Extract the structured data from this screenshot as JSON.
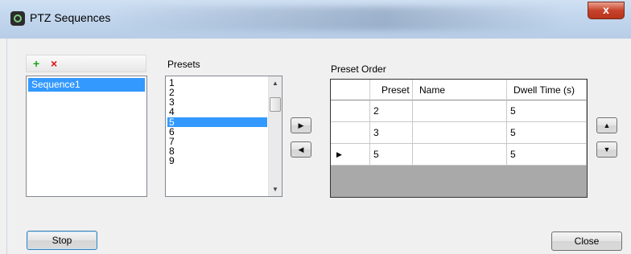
{
  "window": {
    "title": "PTZ Sequences",
    "close_glyph": "x"
  },
  "sequences": {
    "toolbar": {
      "add_glyph": "+",
      "delete_glyph": "×"
    },
    "items": [
      "Sequence1"
    ],
    "selected": "Sequence1"
  },
  "presets": {
    "label": "Presets",
    "items": [
      "1",
      "2",
      "3",
      "4",
      "5",
      "6",
      "7",
      "8",
      "9"
    ],
    "selected": "5"
  },
  "transfer": {
    "add_glyph": "▶",
    "remove_glyph": "◀"
  },
  "preset_order": {
    "label": "Preset Order",
    "columns": [
      "Preset",
      "Name",
      "Dwell Time (s)"
    ],
    "rows": [
      {
        "preset": "2",
        "name": "",
        "dwell": "5"
      },
      {
        "preset": "3",
        "name": "",
        "dwell": "5"
      },
      {
        "preset": "5",
        "name": "",
        "dwell": "5"
      }
    ],
    "current_row_glyph": "▶"
  },
  "reorder": {
    "up_glyph": "▲",
    "down_glyph": "▼"
  },
  "buttons": {
    "stop": "Stop",
    "close": "Close"
  }
}
